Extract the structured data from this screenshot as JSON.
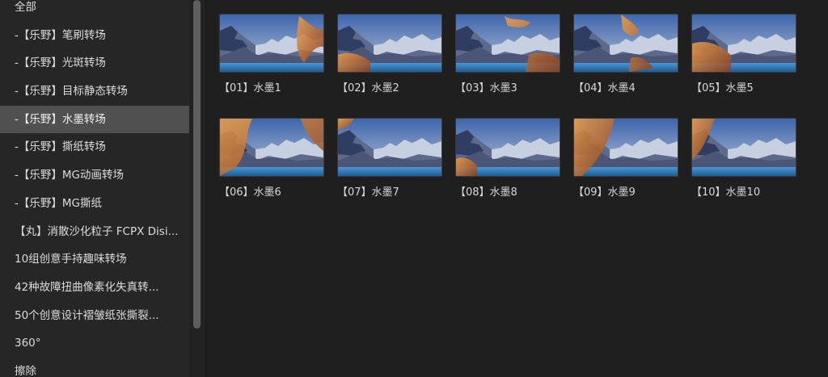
{
  "sidebar": {
    "items": [
      {
        "label": "全部",
        "selected": false
      },
      {
        "label": "-【乐野】笔刷转场",
        "selected": false
      },
      {
        "label": "-【乐野】光斑转场",
        "selected": false
      },
      {
        "label": "-【乐野】目标静态转场",
        "selected": false
      },
      {
        "label": "-【乐野】水墨转场",
        "selected": true
      },
      {
        "label": "-【乐野】撕纸转场",
        "selected": false
      },
      {
        "label": "-【乐野】MG动画转场",
        "selected": false
      },
      {
        "label": "-【乐野】MG撕纸",
        "selected": false
      },
      {
        "label": "【丸】消散沙化粒子 FCPX Disi...",
        "selected": false
      },
      {
        "label": "10组创意手持趣味转场",
        "selected": false
      },
      {
        "label": "42种故障扭曲像素化失真转...",
        "selected": false
      },
      {
        "label": "50个创意设计褶皱纸张撕裂...",
        "selected": false
      },
      {
        "label": "360°",
        "selected": false
      },
      {
        "label": "擦除",
        "selected": false
      }
    ]
  },
  "browser": {
    "items": [
      {
        "label": "【01】水墨1"
      },
      {
        "label": "【02】水墨2"
      },
      {
        "label": "【03】水墨3"
      },
      {
        "label": "【04】水墨4"
      },
      {
        "label": "【05】水墨5"
      },
      {
        "label": "【06】水墨6"
      },
      {
        "label": "【07】水墨7"
      },
      {
        "label": "【08】水墨8"
      },
      {
        "label": "【09】水墨9"
      },
      {
        "label": "【10】水墨10"
      }
    ]
  },
  "colors": {
    "selection": "#505050",
    "sky_top": "#4a72b8",
    "sky_bottom": "#e7b98a",
    "mountain": "#5f6f92",
    "snow": "#dfe6f2",
    "lake": "#3a86c6",
    "ink_orange": "#e0843a"
  }
}
